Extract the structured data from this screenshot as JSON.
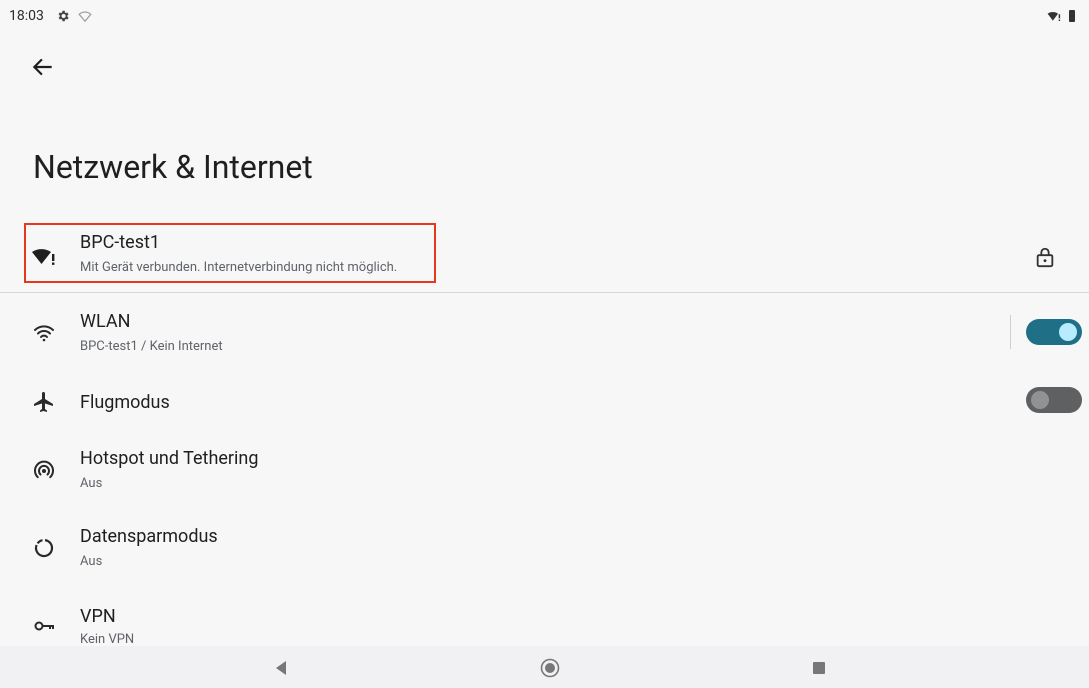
{
  "status": {
    "time": "18:03"
  },
  "page": {
    "title": "Netzwerk & Internet"
  },
  "connection": {
    "ssid": "BPC-test1",
    "status": "Mit Gerät verbunden. Internetverbindung nicht möglich."
  },
  "items": [
    {
      "title": "WLAN",
      "sub": "BPC-test1 / Kein Internet",
      "icon": "wifi-icon",
      "toggle": "on"
    },
    {
      "title": "Flugmodus",
      "sub": "",
      "icon": "airplane-icon",
      "toggle": "off"
    },
    {
      "title": "Hotspot und Tethering",
      "sub": "Aus",
      "icon": "hotspot-icon"
    },
    {
      "title": "Datensparmodus",
      "sub": "Aus",
      "icon": "data-saver-icon"
    },
    {
      "title": "VPN",
      "sub": "Kein VPN",
      "icon": "vpn-key-icon"
    }
  ],
  "colors": {
    "toggle_on": "#1f6f87",
    "highlight": "#e5391d"
  }
}
